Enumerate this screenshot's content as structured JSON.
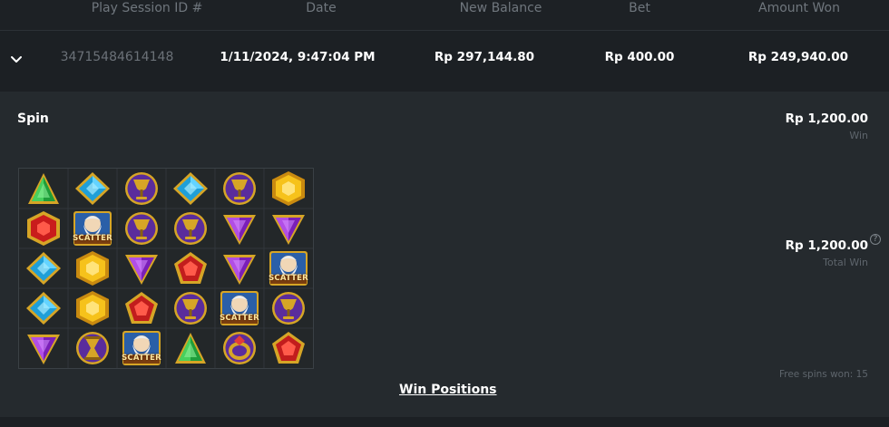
{
  "table": {
    "columns": [
      "Play Session ID #",
      "Date",
      "New Balance",
      "Bet",
      "Amount Won"
    ],
    "row": {
      "session_id": "34715484614148",
      "date": "1/11/2024, 9:47:04 PM",
      "new_balance": "Rp 297,144.80",
      "bet": "Rp 400.00",
      "amount_won": "Rp 249,940.00"
    }
  },
  "detail": {
    "spin_label": "Spin",
    "spin_win_amount": "Rp 1,200.00",
    "spin_win_caption": "Win",
    "total_win_amount": "Rp 1,200.00",
    "total_win_caption": "Total Win",
    "help_glyph": "?",
    "free_spins_text": "Free spins won: 15",
    "win_positions_link": "Win Positions",
    "scatter_text": "SCATTER"
  },
  "reels": [
    [
      "green-triangle-gem",
      "blue-diamond-gem",
      "golden-chalice",
      "blue-diamond-gem",
      "golden-chalice",
      "yellow-hexagon-gem"
    ],
    [
      "red-hexagon-gem",
      "scatter-zeus",
      "golden-chalice",
      "golden-chalice",
      "purple-triangle-gem",
      "purple-triangle-gem"
    ],
    [
      "blue-diamond-gem",
      "yellow-hexagon-gem",
      "purple-triangle-gem",
      "red-pentagon-gem",
      "purple-triangle-gem",
      "scatter-zeus"
    ],
    [
      "blue-diamond-gem",
      "yellow-hexagon-gem",
      "red-pentagon-gem",
      "golden-chalice",
      "scatter-zeus",
      "golden-chalice"
    ],
    [
      "purple-triangle-gem",
      "golden-hourglass",
      "scatter-zeus",
      "green-triangle-gem",
      "golden-ring",
      "red-pentagon-gem"
    ]
  ],
  "colors": {
    "background": "#1c2024",
    "detail_panel": "#252a2e",
    "header_text": "#6f767d",
    "muted_text": "#5e656c",
    "gold": "#d6a526",
    "purple_coin": "#5a2c9c"
  }
}
